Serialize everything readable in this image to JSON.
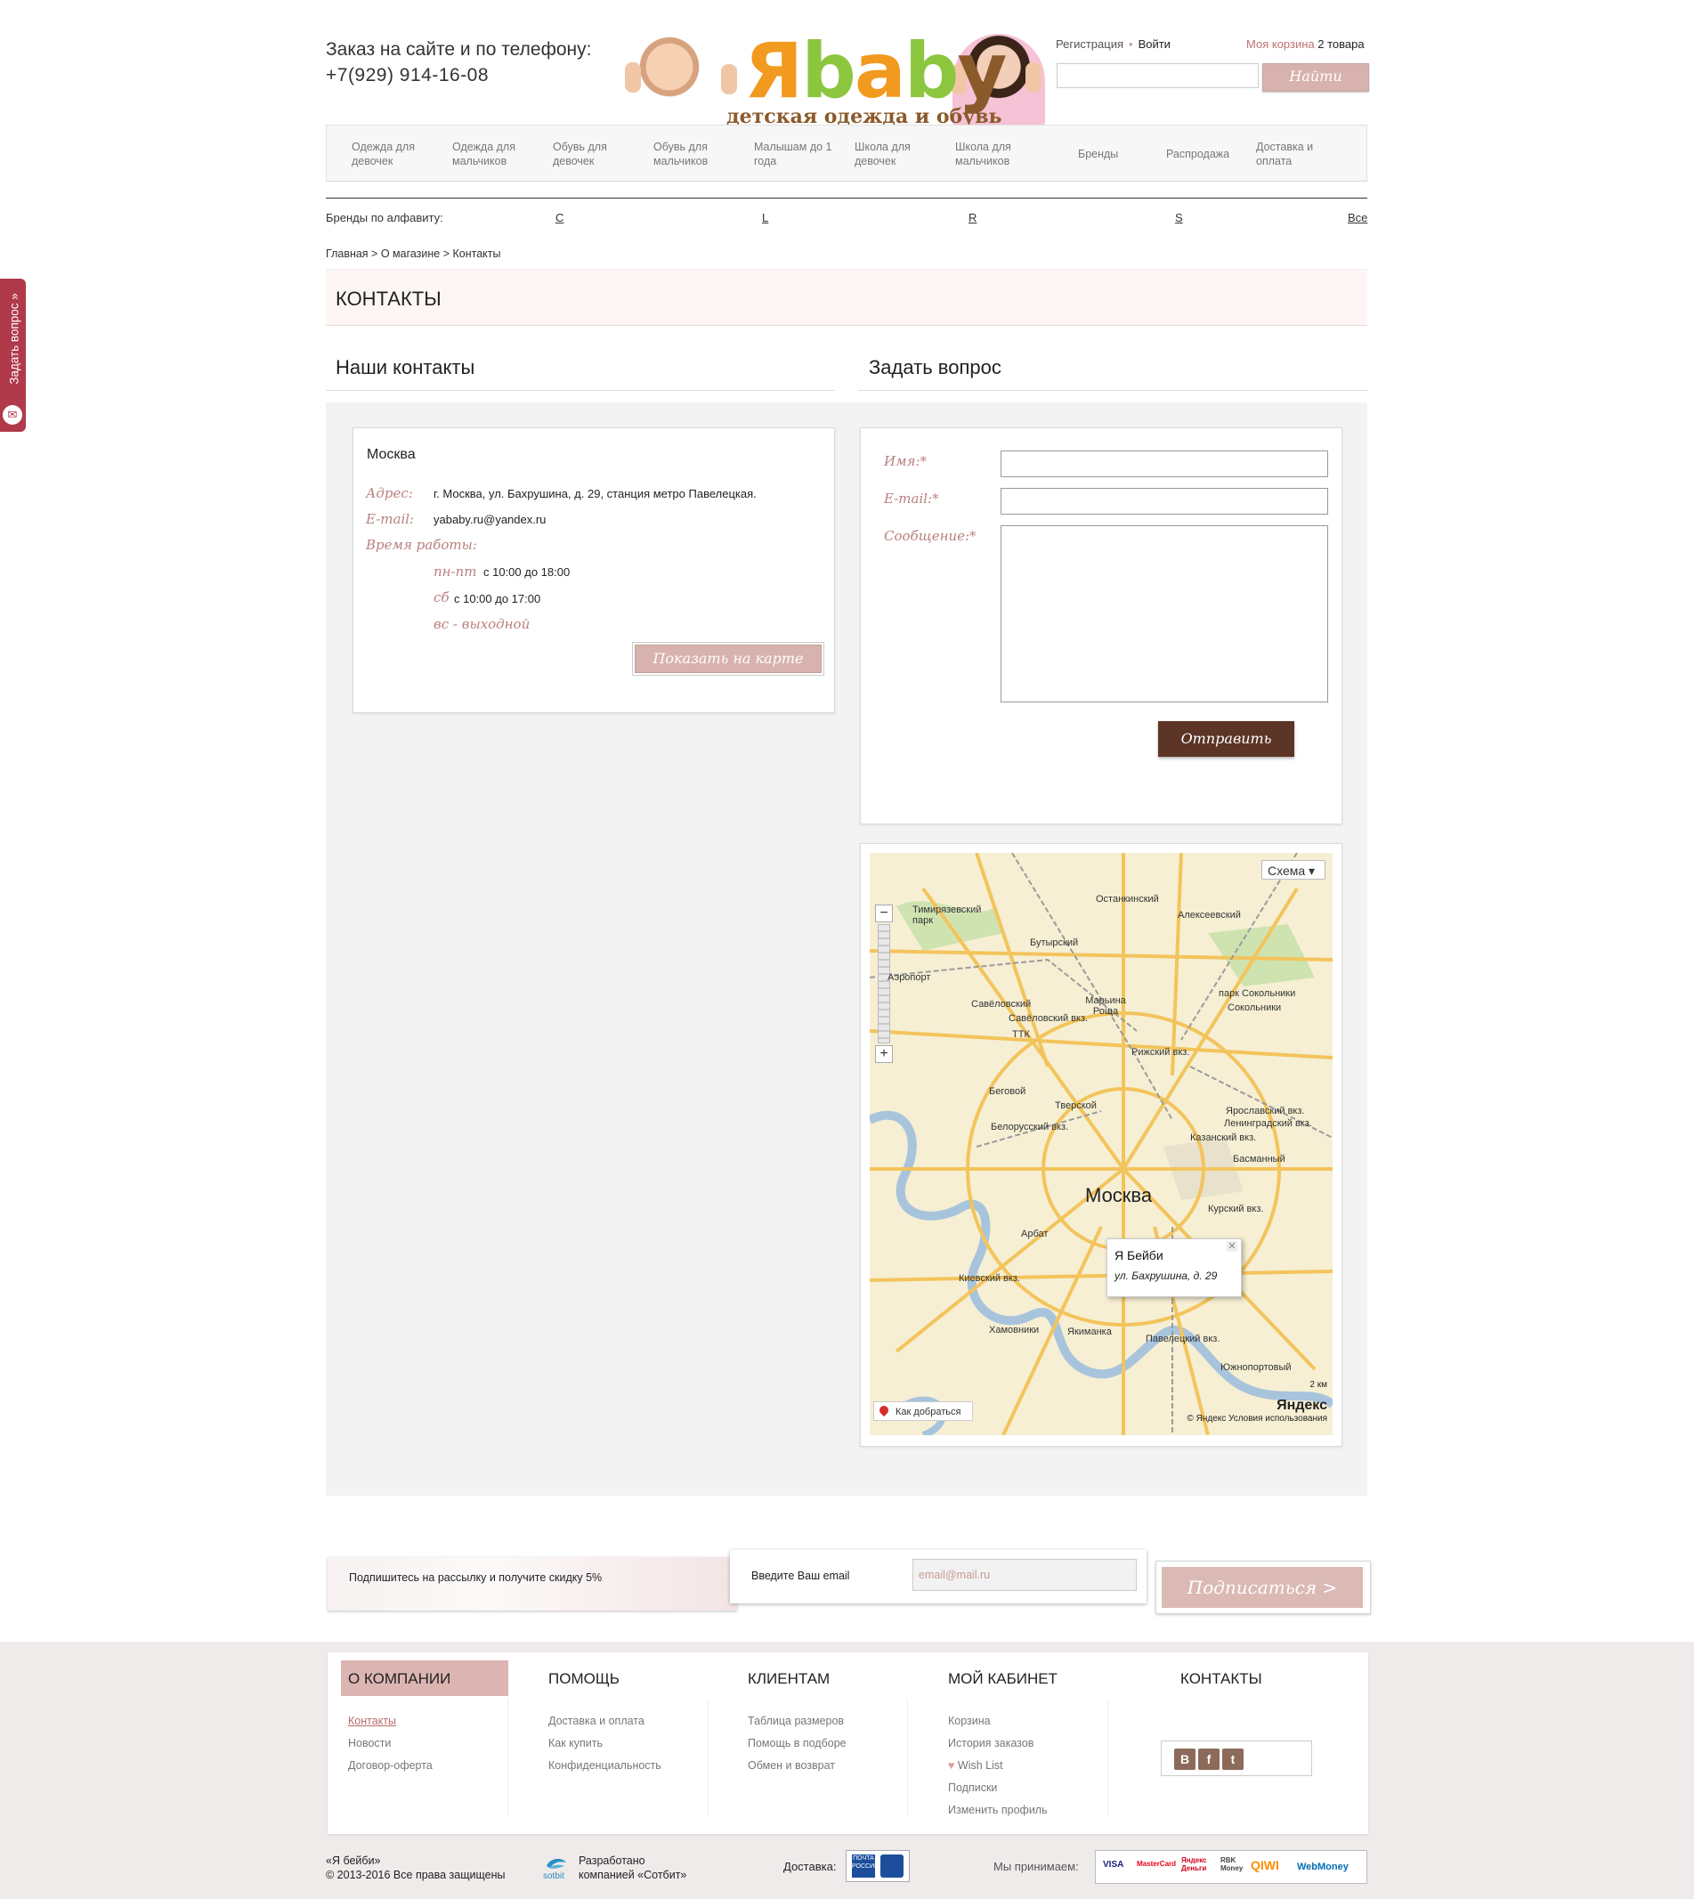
{
  "header": {
    "phone_label": "Заказ на сайте и по телефону:",
    "phone": "+7(929) 914-16-08",
    "logo_text": "Яbaby",
    "logo_sub": "детская одежда и обувь",
    "register": "Регистрация",
    "login": "Войти",
    "cart_label": "Моя корзина",
    "cart_count": "2 товара",
    "search_button": "Найти"
  },
  "nav": {
    "items": [
      "Одежда для девочек",
      "Одежда для мальчиков",
      "Обувь для девочек",
      "Обувь для мальчиков",
      "Малышам до 1 года",
      "Школа для девочек",
      "Школа для мальчиков",
      "Бренды",
      "Распродажа",
      "Доставка и оплата"
    ]
  },
  "brands": {
    "label": "Бренды по алфавиту:",
    "letters": [
      "C",
      "L",
      "R",
      "S",
      "Все"
    ]
  },
  "breadcrumb": "Главная > О магазине > Контакты",
  "page_title": "КОНТАКТЫ",
  "contacts": {
    "heading": "Наши контакты",
    "city": "Москва",
    "address_label": "Адрес:",
    "address": "г. Москва, ул. Бахрушина, д. 29, станция метро Павелецкая.",
    "email_label": "E-mail:",
    "email": "yababy.ru@yandex.ru",
    "hours_label": "Время работы:",
    "weekdays_label": "пн-пт",
    "weekdays_hours": "с 10:00 до 18:00",
    "saturday_label": "сб",
    "saturday_hours": "с 10:00 до 17:00",
    "sunday": "вс - выходной",
    "map_button": "Показать на карте"
  },
  "question": {
    "heading": "Задать вопрос",
    "name_label": "Имя:*",
    "email_label": "E-mail:*",
    "message_label": "Сообщение:*",
    "send_button": "Отправить"
  },
  "map": {
    "type_selector": "Схема ▾",
    "city": "Москва",
    "balloon_title": "Я Бейби",
    "balloon_address": "ул. Бахрушина, д. 29",
    "route_button": "Как добраться",
    "copyright": "© Яндекс  Условия использования",
    "logo": "Яндекс",
    "scale": "2 км",
    "labels": [
      "Останкинский",
      "Тимирязевский парк",
      "Бутырский",
      "Алексеевский",
      "Аэропорт",
      "Савёловский",
      "Марьина Роща",
      "парк Сокольники",
      "Сокольники",
      "Беговой",
      "Тверской",
      "Рижский вкз.",
      "Ярославский вкз.",
      "Ленинградский вкз.",
      "Казанский вкз.",
      "Басманный",
      "Курский вкз.",
      "Арбат",
      "Киевский вкз.",
      "Хамовники",
      "Якиманка",
      "Павелецкий вкз.",
      "Южнопортовый",
      "Белорусский вкз.",
      "Савёловский вкз.",
      "ТТК"
    ]
  },
  "subscribe": {
    "promo": "Подпишитесь на рассылку и получите скидку 5%",
    "email_label": "Введите Ваш email",
    "email_placeholder": "email@mail.ru",
    "button": "Подписаться >"
  },
  "footer": {
    "company_title": "О КОМПАНИИ",
    "company_links": [
      "Контакты",
      "Новости",
      "Договор-оферта"
    ],
    "help_title": "ПОМОЩЬ",
    "help_links": [
      "Доставка и оплата",
      "Как купить",
      "Конфиденциальность"
    ],
    "clients_title": "КЛИЕНТАМ",
    "clients_links": [
      "Таблица размеров",
      "Помощь в подборе",
      "Обмен и возврат"
    ],
    "cabinet_title": "МОЙ КАБИНЕТ",
    "cabinet_links": [
      "Корзина",
      "История заказов",
      "Wish List",
      "Подписки",
      "Изменить профиль"
    ],
    "contacts_title": "КОНТАКТЫ",
    "copyright_1": "«Я бейби»",
    "copyright_2": "© 2013-2016 Все права защищены",
    "developer_1": "Разработано",
    "developer_2": "компанией «Сотбит»",
    "sotbit": "sotbit",
    "delivery_label": "Доставка:",
    "post_logo": "ПОЧТА РОССИИ",
    "pay_label": "Мы принимаем:",
    "pay_methods": [
      "VISA",
      "MasterCard",
      "Яндекс Деньги",
      "RBK Money",
      "QIWI",
      "WebMoney"
    ]
  },
  "side_tab": "Задать вопрос »",
  "colors": {
    "accent_pink": "#d8b2ae",
    "accent_brown": "#5c3526",
    "side_tab": "#b0394a"
  }
}
